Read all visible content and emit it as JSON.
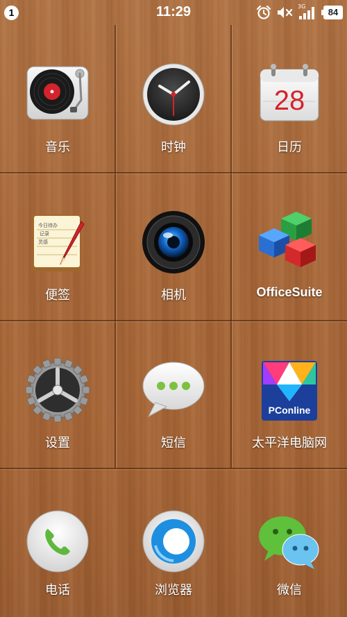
{
  "status_bar": {
    "notification_count": "1",
    "time": "11:29",
    "network": "3G",
    "battery_level": "84",
    "icons": [
      "alarm-icon",
      "mute-icon",
      "signal-icon",
      "battery-icon"
    ]
  },
  "apps": [
    {
      "label": "音乐",
      "icon": "music-turntable-icon"
    },
    {
      "label": "时钟",
      "icon": "clock-icon"
    },
    {
      "label": "日历",
      "icon": "calendar-icon",
      "badge_text": "28"
    },
    {
      "label": "便签",
      "icon": "notepad-icon",
      "note_lines": [
        "今日待办",
        "记录",
        "灵感"
      ]
    },
    {
      "label": "相机",
      "icon": "camera-lens-icon"
    },
    {
      "label": "OfficeSuite",
      "icon": "officesuite-cubes-icon"
    },
    {
      "label": "设置",
      "icon": "gear-icon"
    },
    {
      "label": "短信",
      "icon": "message-bubble-icon"
    },
    {
      "label": "太平洋电脑网",
      "icon": "pconline-icon",
      "badge_text": "PConline"
    }
  ],
  "dock": [
    {
      "label": "电话",
      "icon": "phone-icon"
    },
    {
      "label": "浏览器",
      "icon": "browser-icon"
    },
    {
      "label": "微信",
      "icon": "wechat-icon"
    }
  ],
  "colors": {
    "wood": "#a9693a",
    "calendar_red": "#d4232b",
    "message_green": "#7cc242",
    "wechat_green": "#5fc13b",
    "browser_blue": "#1e8fe0",
    "pconline_blue": "#1b3f9a"
  }
}
